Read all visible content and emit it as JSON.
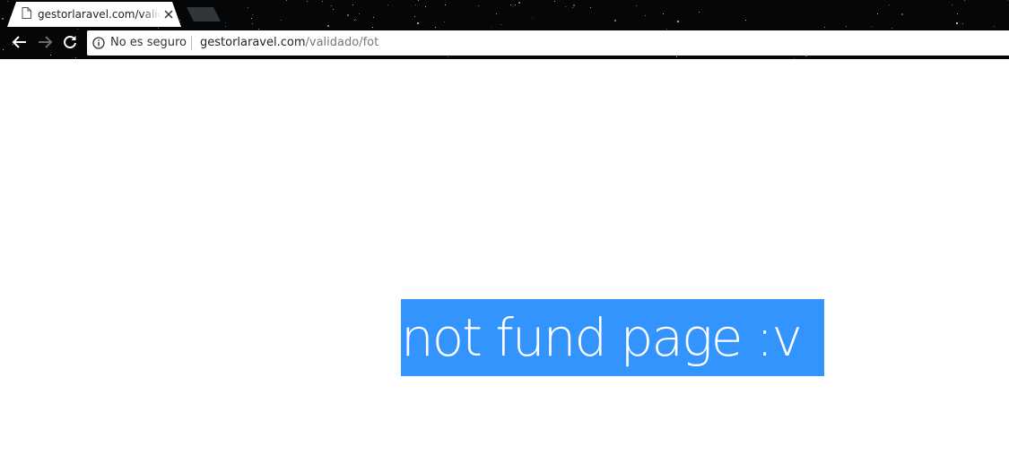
{
  "browser": {
    "tab": {
      "title": "gestorlaravel.com/validado/fot",
      "close_icon": "close-icon",
      "file_icon": "page-icon"
    },
    "toolbar": {
      "back_icon": "arrow-left-icon",
      "forward_icon": "arrow-right-icon",
      "reload_icon": "reload-icon"
    },
    "omnibox": {
      "security_icon": "info-icon",
      "security_label": "No es seguro",
      "url_host": "gestorlaravel.com",
      "url_path": "/validado/fot"
    }
  },
  "page": {
    "message": "not fund page :v",
    "highlight_color": "#3394fe"
  }
}
